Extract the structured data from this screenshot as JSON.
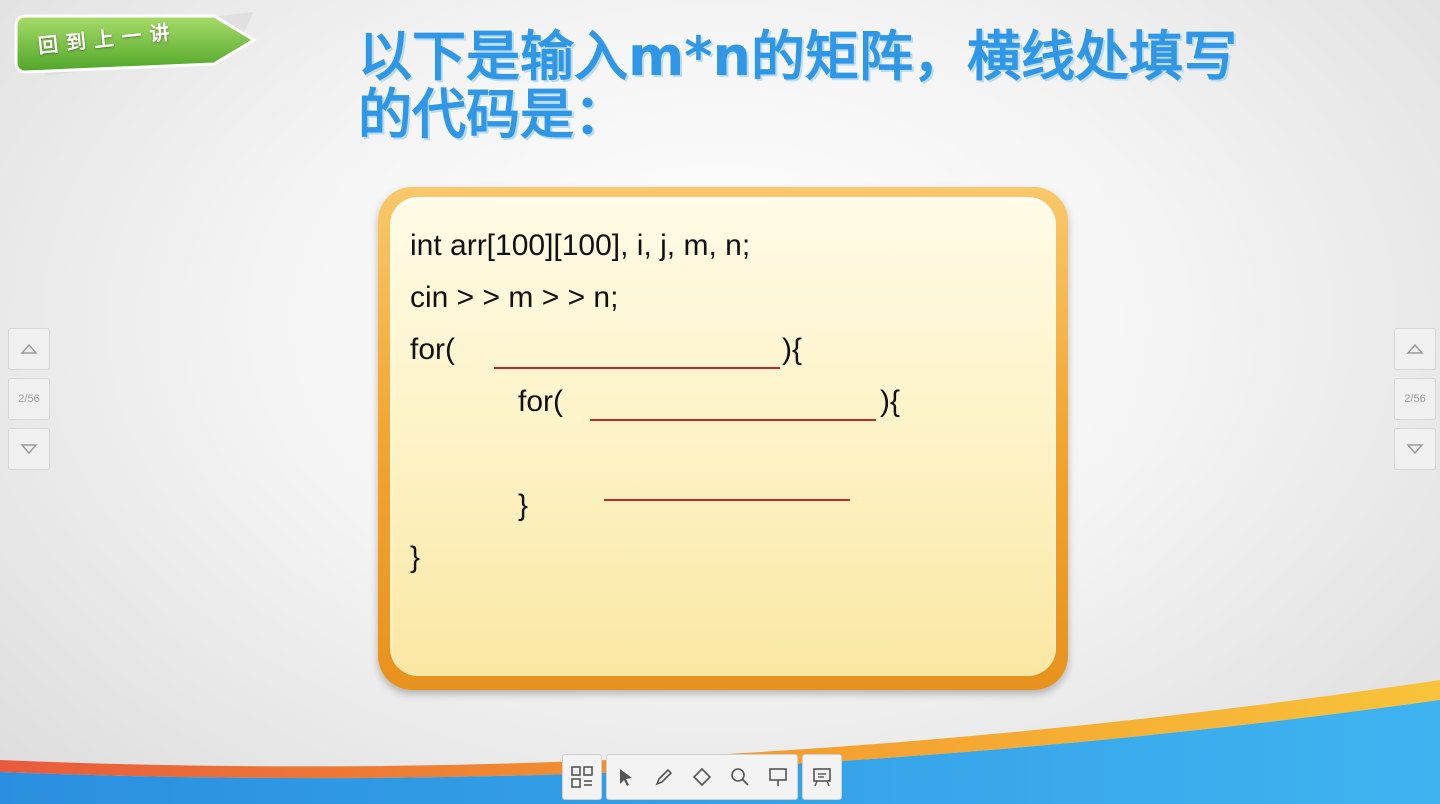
{
  "back_button": {
    "label": "回到上一讲"
  },
  "question": {
    "title": "以下是输入m*n的矩阵，横线处填写的代码是："
  },
  "code": {
    "line1": "int arr[100][100], i, j, m, n;",
    "line2": "cin > > m > > n;",
    "line3_prefix": "for(",
    "line3_suffix": "){",
    "line4_prefix": "for(",
    "line4_suffix": "){",
    "line5": "}",
    "line6": "}"
  },
  "pager_left": {
    "up_icon": "triangle-up-icon",
    "page": "2/56",
    "down_icon": "triangle-down-icon"
  },
  "pager_right": {
    "up_icon": "triangle-up-icon",
    "page": "2/56",
    "down_icon": "triangle-down-icon"
  },
  "toolbar": {
    "items": [
      "thumbnails-icon",
      "pointer-icon",
      "pen-icon",
      "eraser-icon",
      "zoom-icon",
      "presentation-icon",
      "blackboard-icon"
    ]
  },
  "colors": {
    "title": "#2f97e6",
    "blank_line": "#c0282b",
    "frame": "#f2a531"
  }
}
